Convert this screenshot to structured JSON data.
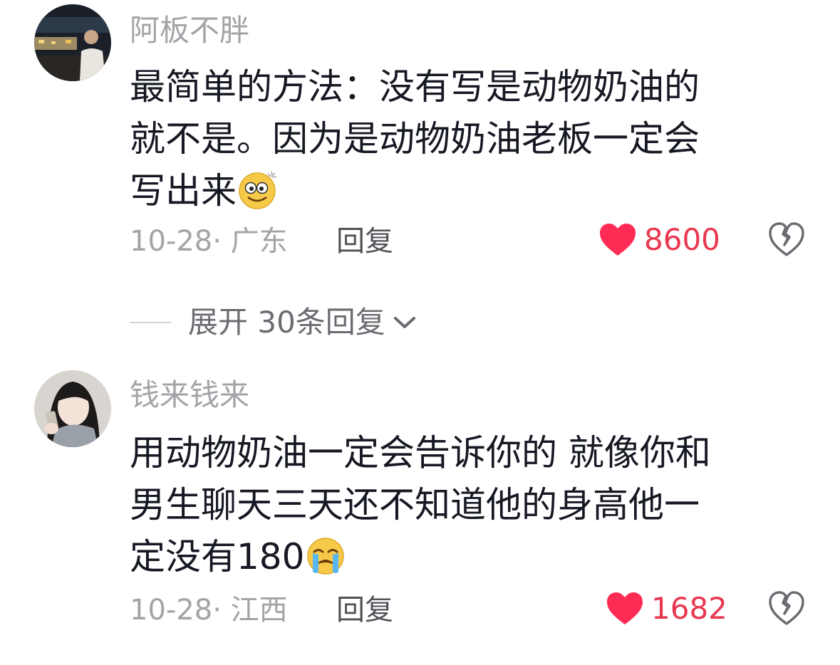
{
  "comments": [
    {
      "username": "阿板不胖",
      "lines": [
        "最简单的方法：没有写是动物奶油的",
        "就不是。因为是动物奶油老板一定会",
        "写出来"
      ],
      "emoji": "dizzy-face-emoji",
      "date_location": "10-28· 广东",
      "reply_label": "回复",
      "likes": "8600",
      "avatar": "avatar-man-night"
    },
    {
      "username": "钱来钱来",
      "lines": [
        "用动物奶油一定会告诉你的 就像你和",
        "男生聊天三天还不知道他的身高他一",
        "定没有180"
      ],
      "emoji": "loudly-crying-face-emoji",
      "date_location": "10-28· 江西",
      "reply_label": "回复",
      "likes": "1682",
      "avatar": "avatar-girl-phone"
    }
  ],
  "expand_replies": {
    "label": "展开 30条回复"
  },
  "colors": {
    "like": "#fe2c55",
    "like_text": "#e8374f",
    "muted": "#a3a3a8",
    "text": "#161823"
  }
}
